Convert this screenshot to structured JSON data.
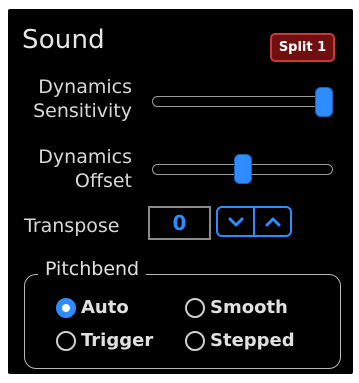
{
  "header": {
    "title": "Sound",
    "split_button_label": "Split 1"
  },
  "dynamics_sensitivity": {
    "label_line1": "Dynamics",
    "label_line2": "Sensitivity",
    "value_fraction": 1.0
  },
  "dynamics_offset": {
    "label_line1": "Dynamics",
    "label_line2": "Offset",
    "value_fraction": 0.5
  },
  "transpose": {
    "label": "Transpose",
    "value": "0",
    "down_icon": "chevron-down-icon",
    "up_icon": "chevron-up-icon"
  },
  "pitchbend": {
    "legend": "Pitchbend",
    "selected": "Auto",
    "options": [
      {
        "label": "Auto",
        "checked": true
      },
      {
        "label": "Smooth",
        "checked": false
      },
      {
        "label": "Trigger",
        "checked": false
      },
      {
        "label": "Stepped",
        "checked": false
      }
    ]
  },
  "colors": {
    "background": "#000000",
    "accent_blue": "#2f8cff",
    "split_button_bg": "#6e1010",
    "split_button_border": "#c73a3a",
    "text": "#d8d8d8"
  }
}
